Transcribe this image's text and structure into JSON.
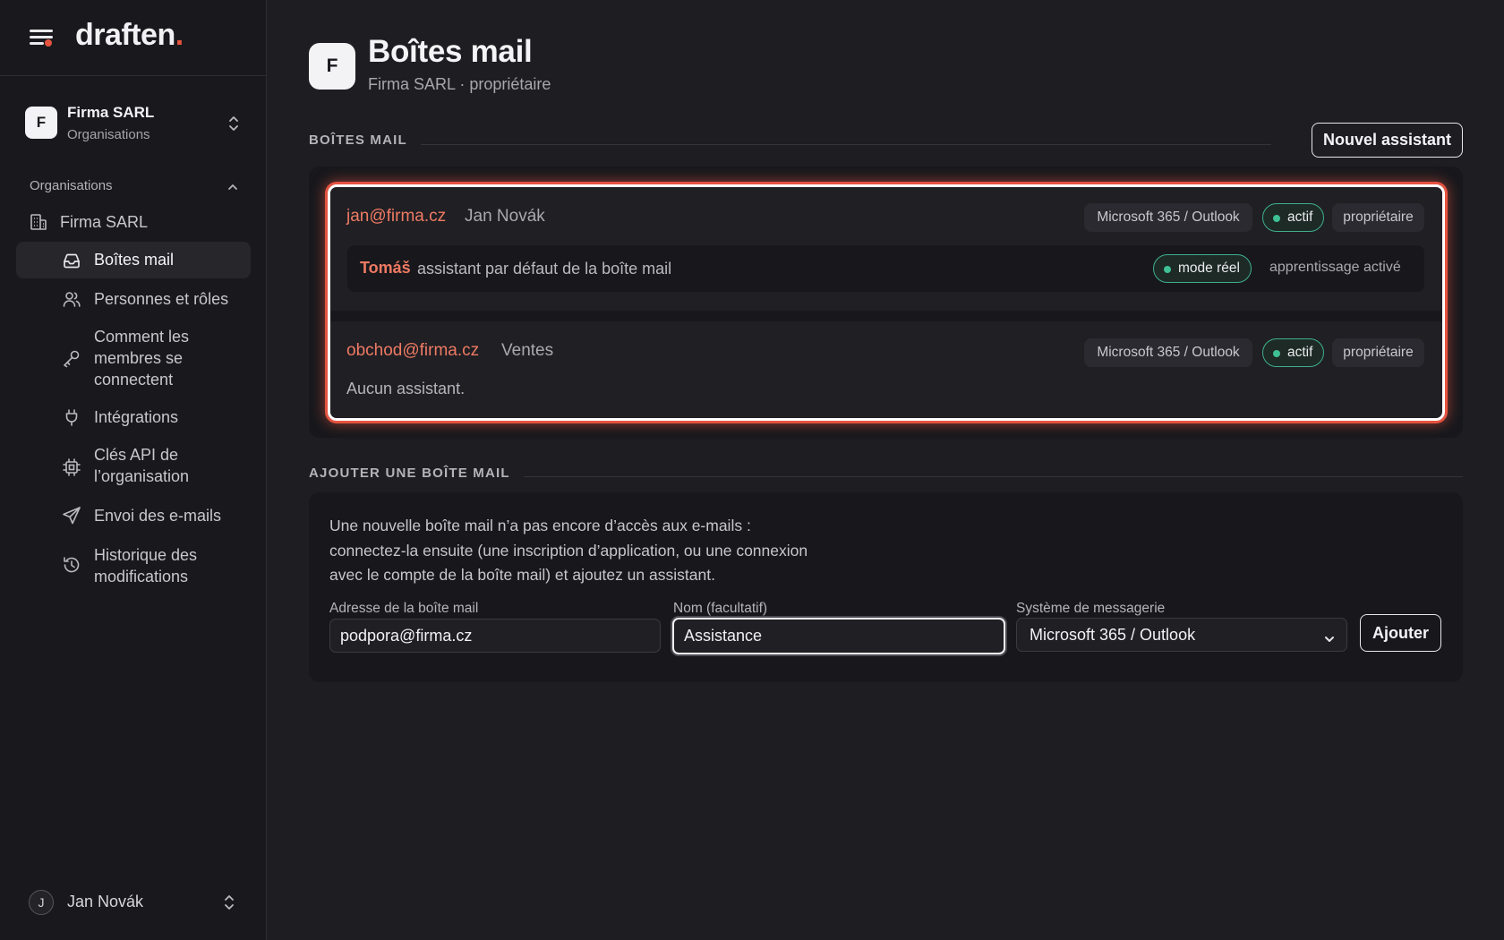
{
  "brand": {
    "name": "draften",
    "dot": "."
  },
  "org": {
    "initial": "F",
    "name": "Firma SARL",
    "subtitle": "Organisations"
  },
  "sidebar": {
    "section_label": "Organisations",
    "org_item": "Firma SARL",
    "items": [
      {
        "id": "mailboxes",
        "label": "Boîtes mail",
        "icon": "inbox-icon",
        "active": true
      },
      {
        "id": "people",
        "label": "Personnes et rôles",
        "icon": "users-icon"
      },
      {
        "id": "login",
        "label": "Comment les membres se connectent",
        "icon": "key-icon"
      },
      {
        "id": "integrations",
        "label": "Intégrations",
        "icon": "plug-icon"
      },
      {
        "id": "api-keys",
        "label": "Clés API de l’organisation",
        "icon": "chip-icon"
      },
      {
        "id": "email-sending",
        "label": "Envoi des e-mails",
        "icon": "send-icon"
      },
      {
        "id": "history",
        "label": "Historique des modifications",
        "icon": "history-icon"
      }
    ]
  },
  "user": {
    "initial": "J",
    "name": "Jan Novák"
  },
  "page": {
    "avatar": "F",
    "title": "Boîtes mail",
    "subtitle": "Firma SARL · propriétaire"
  },
  "mailboxes_section": {
    "label": "BOÎTES MAIL",
    "new_assistant_button": "Nouvel assistant",
    "mailboxes": [
      {
        "email": "jan@firma.cz",
        "name": "Jan Novák",
        "provider": "Microsoft 365 / Outlook",
        "status": "actif",
        "role": "propriétaire",
        "assistant": {
          "name": "Tomáš",
          "description": "assistant par défaut de la boîte mail",
          "mode": "mode réel",
          "learning": "apprentissage activé"
        }
      },
      {
        "email": "obchod@firma.cz",
        "name": "Ventes",
        "provider": "Microsoft 365 / Outlook",
        "status": "actif",
        "role": "propriétaire",
        "no_assistant": "Aucun assistant."
      }
    ]
  },
  "add_section": {
    "label": "AJOUTER UNE BOÎTE MAIL",
    "description_lines": [
      "Une nouvelle boîte mail n’a pas encore d’accès aux e-mails :",
      "connectez-la ensuite (une inscription d’application, ou une connexion",
      "avec le compte de la boîte mail) et ajoutez un assistant."
    ],
    "address_label": "Adresse de la boîte mail",
    "address_value": "podpora@firma.cz",
    "name_label": "Nom (facultatif)",
    "name_value": "Assistance",
    "system_label": "Système de messagerie",
    "system_value": "Microsoft 365 / Outlook",
    "add_button": "Ajouter"
  },
  "colors": {
    "accent": "#e5533f",
    "email_link": "#ef7a63",
    "status_green": "#3fae8d",
    "background": "#1d1d22",
    "sidebar": "#19191d"
  }
}
